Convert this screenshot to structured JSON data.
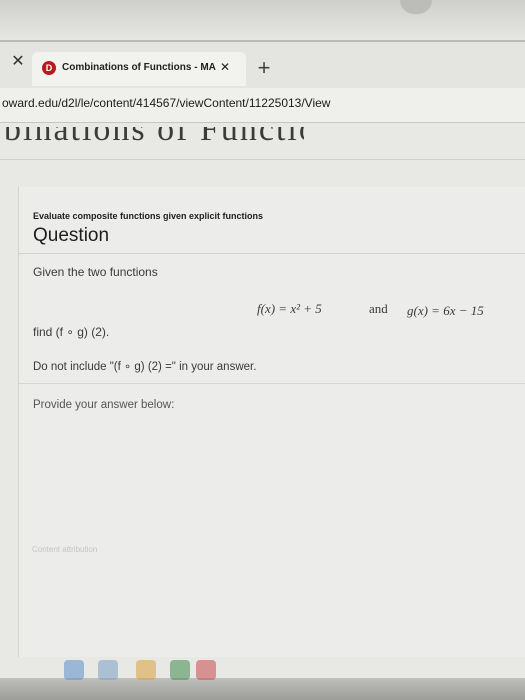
{
  "browser": {
    "close_window": "✕",
    "tab": {
      "favicon_letter": "D",
      "title": "Combinations of Functions - MA",
      "close": "✕"
    },
    "new_tab": "+",
    "url": "oward.edu/d2l/le/content/414567/viewContent/11225013/View"
  },
  "page": {
    "cut_heading": "binations of Functions",
    "subtitle": "Evaluate composite functions given explicit functions",
    "question_heading": "Question",
    "prompt": "Given the two functions",
    "f_def": "f(x) = x² + 5",
    "and_word": "and",
    "g_def": "g(x) = 6x − 15",
    "find": "find (f ∘ g) (2).",
    "instruction": "Do not include \"(f ∘ g) (2) =\" in your answer.",
    "answer_prompt": "Provide your answer below:",
    "attribution": "Content attribution"
  },
  "colors": {
    "favicon": "#b7191e",
    "background": "#e8e8e5"
  }
}
